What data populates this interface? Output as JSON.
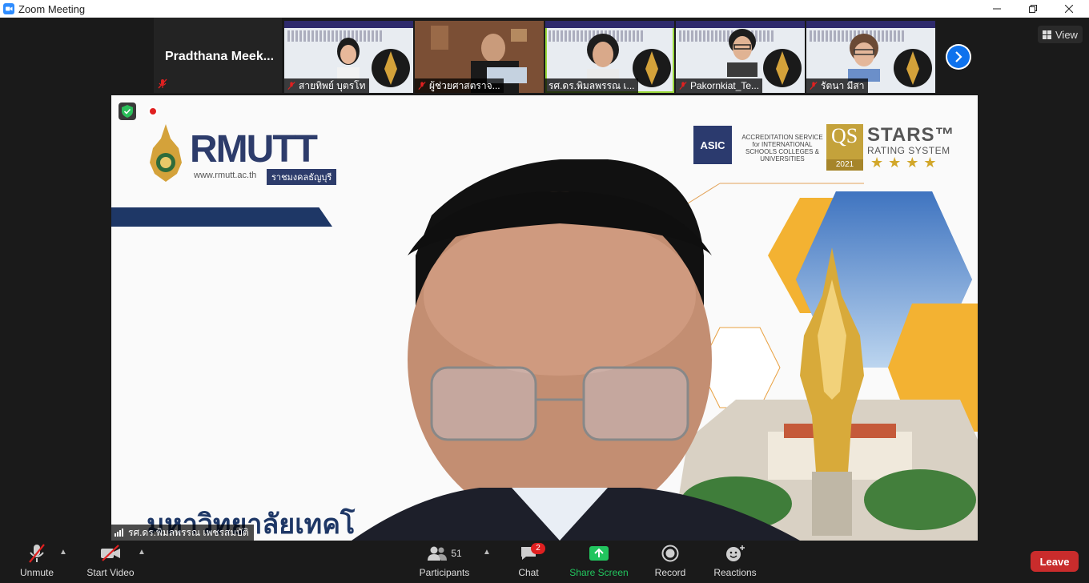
{
  "window": {
    "title": "Zoom Meeting"
  },
  "strip": {
    "current_user_name": "Pradthana  Meek...",
    "tiles": [
      {
        "label": "สายทิพย์  บุตรโท"
      },
      {
        "label": "ผู้ช่วยศาสตราจ..."
      },
      {
        "label": "รศ.ดร.พิมลพรรณ เ..."
      },
      {
        "label": "Pakornkiat_Te..."
      },
      {
        "label": "รัตนา มีสา"
      }
    ]
  },
  "view_button": {
    "label": "View"
  },
  "main_video": {
    "speaker_name": "รศ.ดร.พิมลพรรณ เพชรสมบัติ",
    "slide": {
      "logo_text": "RMUTT",
      "logo_url": "www.rmutt.ac.th",
      "logo_thai": "ราชมงคลธัญบุรี",
      "asic_logo": "ASIC",
      "asic_text": "ACCREDITATION SERVICE for INTERNATIONAL SCHOOLS COLLEGES & UNIVERSITIES",
      "qs_logo": "QS",
      "qs_year": "2021",
      "stars_title": "STARS™",
      "stars_subtitle": "RATING SYSTEM",
      "stars_glyphs": "★★★★",
      "bottom_text": "มหาวิทยาลัยเทคโ"
    }
  },
  "toolbar": {
    "unmute": "Unmute",
    "start_video": "Start Video",
    "participants": "Participants",
    "participants_count": "51",
    "chat": "Chat",
    "chat_badge": "2",
    "share_screen": "Share Screen",
    "record": "Record",
    "reactions": "Reactions",
    "leave": "Leave"
  },
  "colors": {
    "zoom_blue": "#0e72ed",
    "share_green": "#22c55e",
    "leave_red": "#c92c2c",
    "muted_red": "#e02020",
    "rmutt_navy": "#1e3766"
  }
}
